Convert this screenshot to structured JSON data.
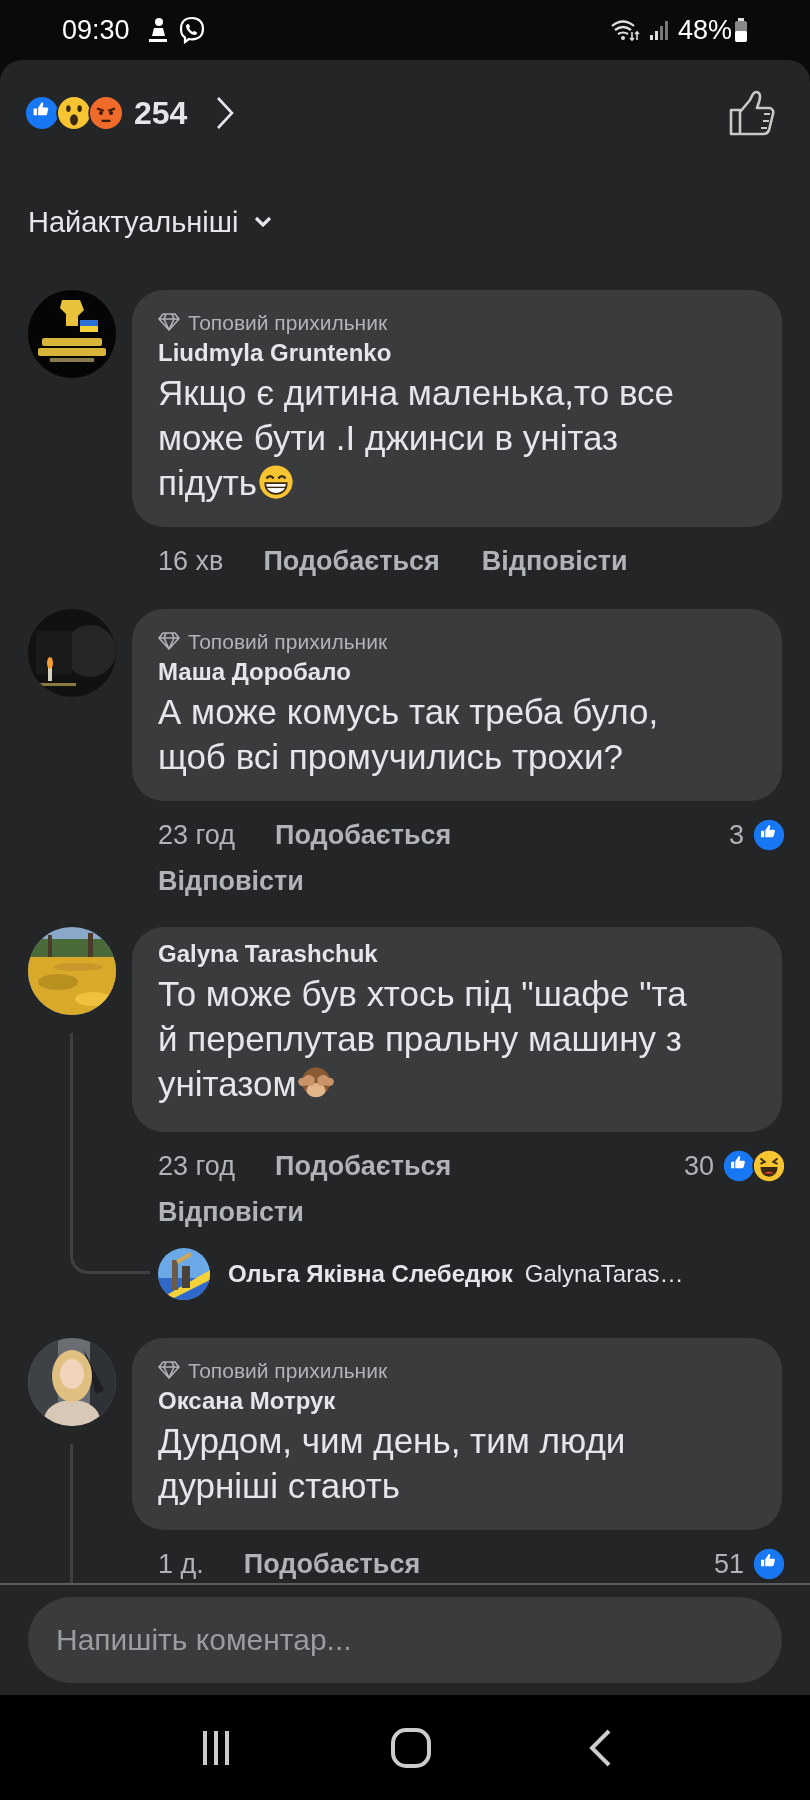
{
  "status_bar": {
    "time": "09:30",
    "battery": "48%"
  },
  "reactions": {
    "icons": [
      {
        "kind": "like"
      },
      {
        "kind": "wow"
      },
      {
        "kind": "angry"
      }
    ],
    "count": "254"
  },
  "sort": {
    "label": "Найактуальніші"
  },
  "comments": [
    {
      "badge": "Топовий прихильник",
      "name": "Liudmyla Gruntenko",
      "text": "Якщо є дитина маленька,то все може бути .І джинси в унітаз підуть",
      "emoji": {
        "kind": "grin"
      },
      "time": "16 хв",
      "like_label": "Подобається",
      "reply_label": "Відповісти",
      "has_replies": false
    },
    {
      "badge": "Топовий прихильник",
      "name": "Маша Доробало",
      "text": "А може комусь так треба було, щоб всі промучились трохи?",
      "time": "23 год",
      "like_label": "Подобається",
      "reply_label": "Відповісти",
      "reaction_count": "3",
      "reaction_icons": [
        {
          "kind": "like"
        }
      ],
      "has_replies": false
    },
    {
      "name": "Galyna Tarashchuk",
      "text": "То може був хтось під \"шафе \"та й переплутав пральну машину з унітазом",
      "emoji": {
        "kind": "monkey"
      },
      "time": "23 год",
      "like_label": "Подобається",
      "reply_label": "Відповісти",
      "reaction_count": "30",
      "reaction_icons": [
        {
          "kind": "like"
        },
        {
          "kind": "haha"
        }
      ],
      "has_replies": true,
      "reply": {
        "name": "Ольга Яківна Слебедюк",
        "text": "GalynaTaras…"
      }
    },
    {
      "badge": "Топовий прихильник",
      "name": "Оксана Мотрук",
      "text": "Дурдом, чим день, тим люди дурніші стають",
      "time": "1 д.",
      "like_label": "Подобається",
      "reaction_count": "51",
      "reaction_icons": [
        {
          "kind": "like"
        }
      ],
      "has_replies": true
    }
  ],
  "composer": {
    "placeholder": "Напишіть коментар..."
  }
}
